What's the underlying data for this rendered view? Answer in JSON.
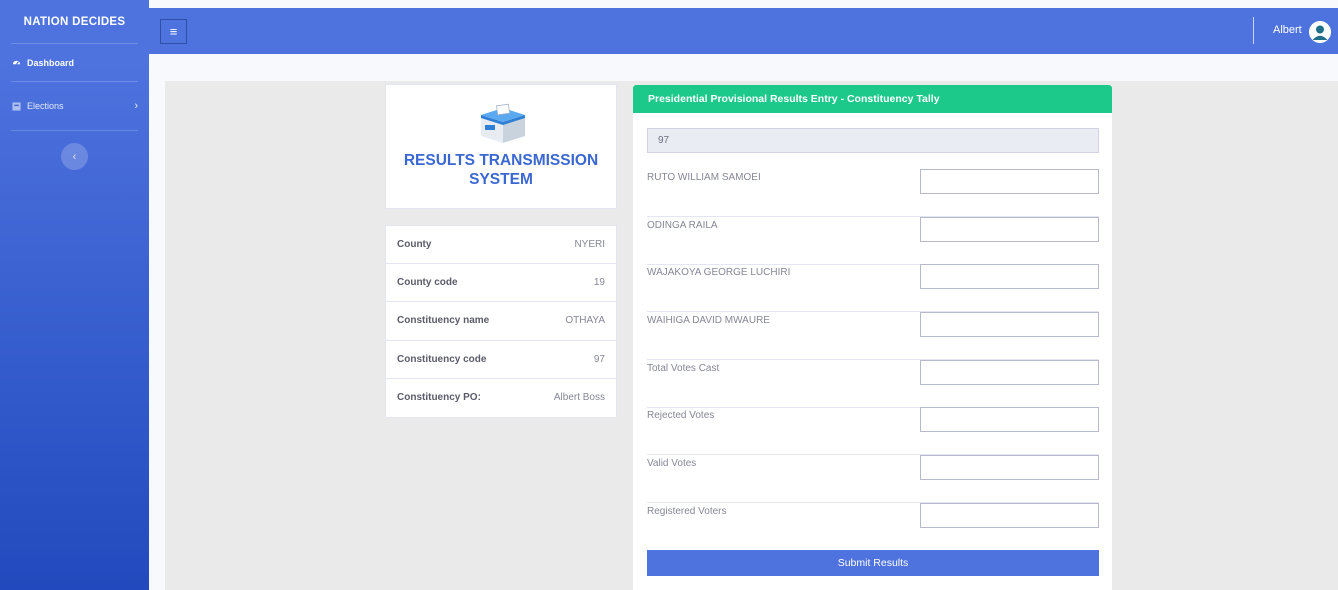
{
  "sidebar": {
    "brand": "NATION DECIDES",
    "items": [
      {
        "label": "Dashboard",
        "icon": "tachometer-icon"
      },
      {
        "label": "Elections",
        "icon": "box-icon"
      }
    ]
  },
  "topbar": {
    "user_name": "Albert"
  },
  "logo_card": {
    "title": "RESULTS TRANSMISSION SYSTEM"
  },
  "info": [
    {
      "label": "County",
      "value": "NYERI"
    },
    {
      "label": "County code",
      "value": "19"
    },
    {
      "label": "Constituency name",
      "value": "OTHAYA"
    },
    {
      "label": "Constituency code",
      "value": "97"
    },
    {
      "label": "Constituency PO:",
      "value": "Albert Boss"
    }
  ],
  "form": {
    "header": "Presidential Provisional Results Entry - Constituency Tally",
    "code_value": "97",
    "fields": [
      {
        "label": "RUTO WILLIAM SAMOEI",
        "value": ""
      },
      {
        "label": "ODINGA RAILA",
        "value": ""
      },
      {
        "label": "WAJAKOYA GEORGE LUCHIRI",
        "value": ""
      },
      {
        "label": "WAIHIGA DAVID MWAURE",
        "value": ""
      },
      {
        "label": "Total Votes Cast",
        "value": ""
      },
      {
        "label": "Rejected Votes",
        "value": ""
      },
      {
        "label": "Valid Votes",
        "value": ""
      },
      {
        "label": "Registered Voters",
        "value": ""
      }
    ],
    "submit_label": "Submit Results"
  },
  "colors": {
    "primary": "#4e73df",
    "success": "#1cc88a",
    "title_blue": "#3a67d2"
  }
}
